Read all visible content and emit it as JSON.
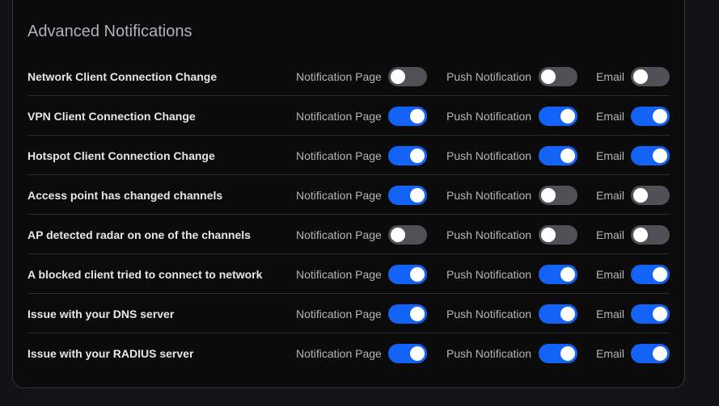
{
  "section": {
    "title": "Advanced Notifications"
  },
  "labels": {
    "notification_page": "Notification Page",
    "push_notification": "Push Notification",
    "email": "Email"
  },
  "rows": [
    {
      "label": "Network Client Connection Change",
      "page": false,
      "push": false,
      "email": false
    },
    {
      "label": "VPN Client Connection Change",
      "page": true,
      "push": true,
      "email": true
    },
    {
      "label": "Hotspot Client Connection Change",
      "page": true,
      "push": true,
      "email": true
    },
    {
      "label": "Access point has changed channels",
      "page": true,
      "push": false,
      "email": false
    },
    {
      "label": "AP detected radar on one of the channels",
      "page": false,
      "push": false,
      "email": false
    },
    {
      "label": "A blocked client tried to connect to network",
      "page": true,
      "push": true,
      "email": true
    },
    {
      "label": "Issue with your DNS server",
      "page": true,
      "push": true,
      "email": true
    },
    {
      "label": "Issue with your RADIUS server",
      "page": true,
      "push": true,
      "email": true
    }
  ],
  "colors": {
    "toggle_on": "#1363f6",
    "toggle_off": "#4f5156"
  }
}
